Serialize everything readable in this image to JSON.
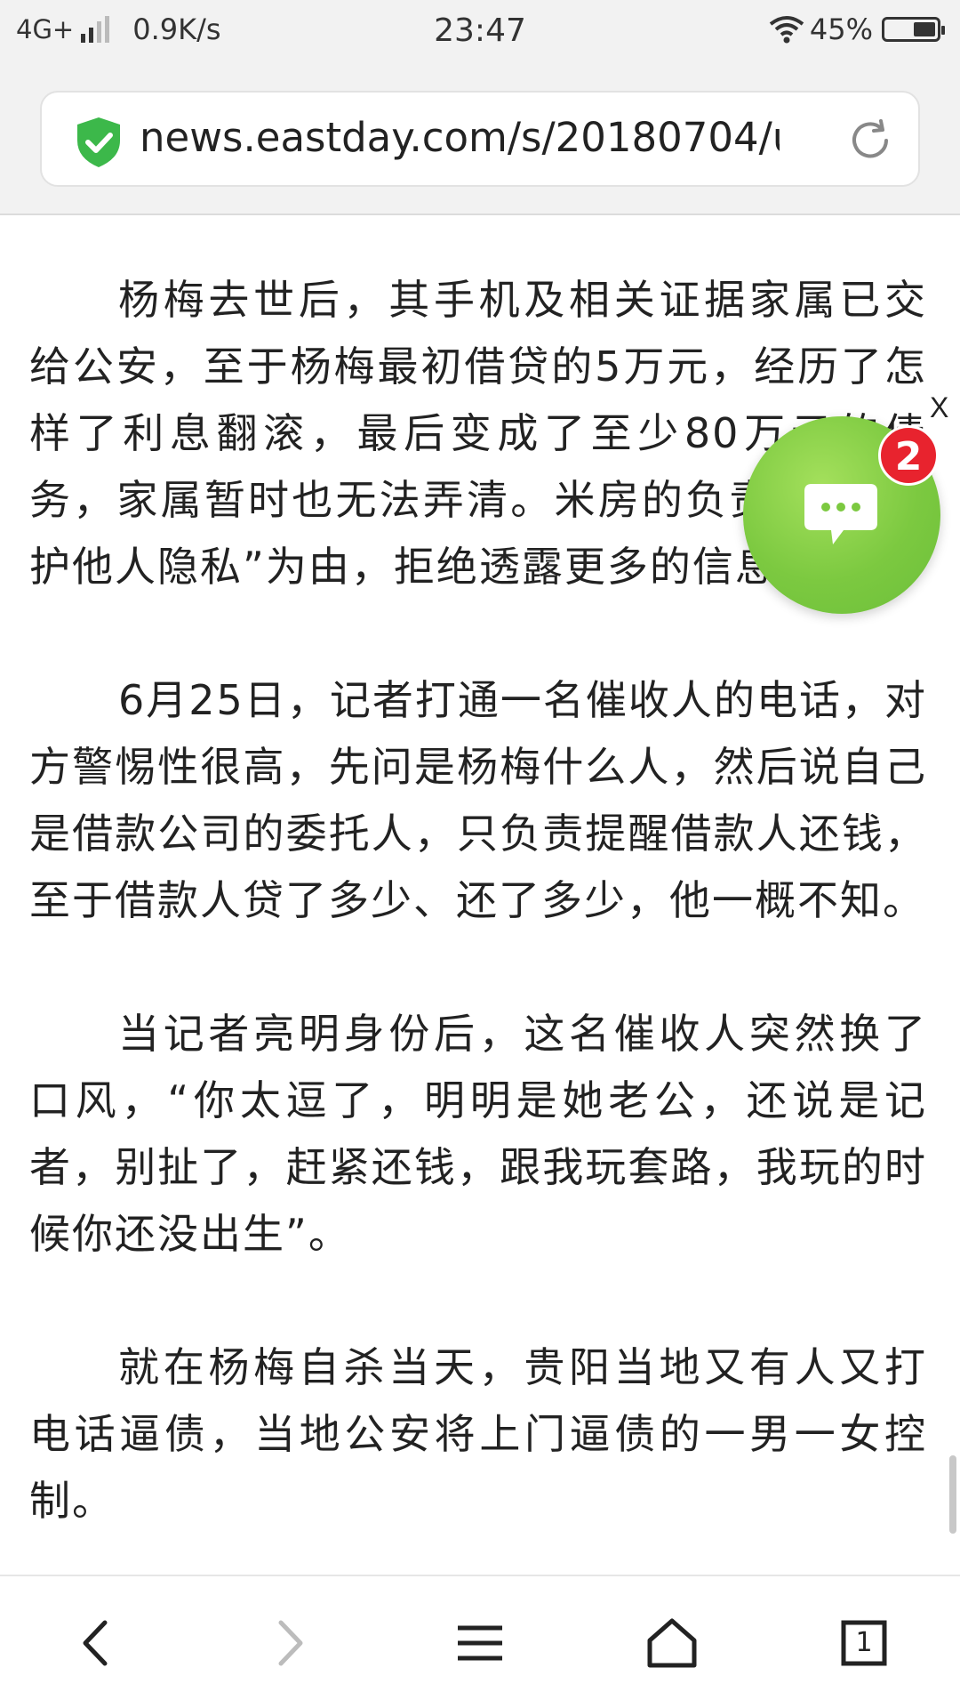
{
  "status_bar": {
    "network": "4G+",
    "speed": "0.9K/s",
    "time": "23:47",
    "battery": "45%",
    "battery_level": 0.45
  },
  "browser": {
    "url": "news.eastday.com/s/20180704/u⋯",
    "secure_color": "#3cb84a"
  },
  "article": {
    "paragraphs": [
      "杨梅去世后，其手机及相关证据家属已交给公安，至于杨梅最初借贷的5万元，经历了怎样了利息翻滚，最后变成了至少80万元的债务，家属暂时也无法弄清。米房的负责人以“保护他人隐私”为由，拒绝透露更多的信息。",
      "6月25日，记者打通一名催收人的电话，对方警惕性很高，先问是杨梅什么人，然后说自己是借款公司的委托人，只负责提醒借款人还钱，至于借款人贷了多少、还了多少，他一概不知。",
      "当记者亮明身份后，这名催收人突然换了口风，“你太逗了，明明是她老公，还说是记者，别扯了，赶紧还钱，跟我玩套路，我玩的时候你还没出生”。",
      "就在杨梅自杀当天，贵阳当地又有人又打电话逼债，当地公安将上门逼债的一男一女控制。"
    ]
  },
  "chat_float": {
    "badge": "2",
    "close": "X",
    "color": "#7cc940",
    "badge_color": "#e8232e"
  },
  "bottom_nav": {
    "tab_count": "1"
  }
}
